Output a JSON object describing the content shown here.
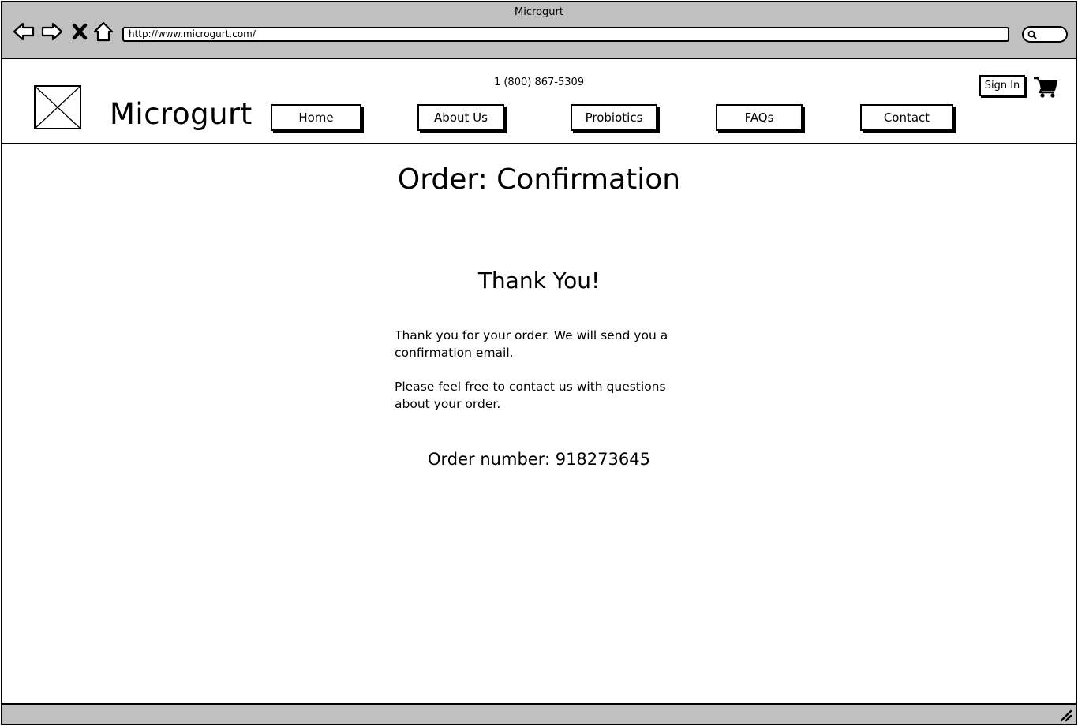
{
  "window": {
    "title": "Microgurt"
  },
  "browser": {
    "url": "http://www.microgurt.com/",
    "icons": [
      "back-arrow-icon",
      "forward-arrow-icon",
      "close-x-icon",
      "home-icon",
      "search-icon"
    ]
  },
  "header": {
    "brand": "Microgurt",
    "phone": "1 (800) 867-5309",
    "sign_in": "Sign In",
    "nav": [
      {
        "label": "Home"
      },
      {
        "label": "About Us"
      },
      {
        "label": "Probiotics"
      },
      {
        "label": "FAQs"
      },
      {
        "label": "Contact"
      }
    ]
  },
  "main": {
    "title": "Order: Confirmation",
    "heading": "Thank You!",
    "paragraph1": "Thank you for your order. We will send you a confirmation email.",
    "paragraph2": "Please feel free to contact us with questions about your order.",
    "order_number": "Order number: 918273645"
  }
}
